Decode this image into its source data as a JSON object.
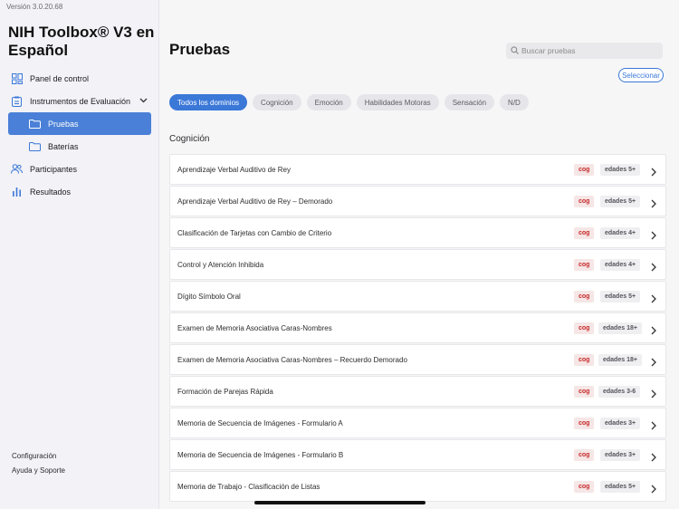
{
  "sidebar": {
    "version": "Versión 3.0.20.68",
    "app_title": "NIH Toolbox® V3 en Español",
    "nav": {
      "panel": "Panel de control",
      "instrumentos": "Instrumentos de Evaluación",
      "pruebas": "Pruebas",
      "baterias": "Baterías",
      "participantes": "Participantes",
      "resultados": "Resultados"
    },
    "footer": {
      "configuracion": "Configuración",
      "ayuda": "Ayuda y Soporte"
    }
  },
  "main": {
    "title": "Pruebas",
    "search_placeholder": "Buscar pruebas",
    "select_label": "Seleccionar",
    "chips": [
      "Todos los dominios",
      "Cognición",
      "Emoción",
      "Habilidades Motoras",
      "Sensación",
      "N/D"
    ],
    "section_title": "Cognición",
    "rows": [
      {
        "name": "Aprendizaje Verbal Auditivo de Rey",
        "tag": "cog",
        "age": "edades 5+"
      },
      {
        "name": "Aprendizaje Verbal Auditivo de Rey – Demorado",
        "tag": "cog",
        "age": "edades 5+"
      },
      {
        "name": "Clasificación de Tarjetas con Cambio de Criterio",
        "tag": "cog",
        "age": "edades 4+"
      },
      {
        "name": "Control y Atención Inhibida",
        "tag": "cog",
        "age": "edades 4+"
      },
      {
        "name": "Dígito Símbolo Oral",
        "tag": "cog",
        "age": "edades 5+"
      },
      {
        "name": "Examen de Memoria Asociativa Caras-Nombres",
        "tag": "cog",
        "age": "edades 18+"
      },
      {
        "name": "Examen de Memoria Asociativa Caras-Nombres – Recuerdo Demorado",
        "tag": "cog",
        "age": "edades 18+"
      },
      {
        "name": "Formación de Parejas Rápida",
        "tag": "cog",
        "age": "edades 3-6"
      },
      {
        "name": "Memoria de Secuencia de Imágenes - Formulario A",
        "tag": "cog",
        "age": "edades 3+"
      },
      {
        "name": "Memoria de Secuencia de Imágenes - Formulario B",
        "tag": "cog",
        "age": "edades 3+"
      },
      {
        "name": "Memoria de Trabajo - Clasificación de Listas",
        "tag": "cog",
        "age": "edades 5+"
      }
    ]
  },
  "colors": {
    "accent": "#3b78d8",
    "nav_active": "#4a80d7",
    "cog_tag_text": "#c62828",
    "cog_tag_bg": "#f6e6e6"
  },
  "icons": {
    "panel": "dashboard-grid-icon",
    "instrumentos": "clipboard-icon",
    "pruebas": "folder-icon",
    "baterias": "folder-icon",
    "participantes": "people-icon",
    "resultados": "bar-chart-icon",
    "search": "search-icon",
    "row_arrow": "chevron-right-icon"
  }
}
